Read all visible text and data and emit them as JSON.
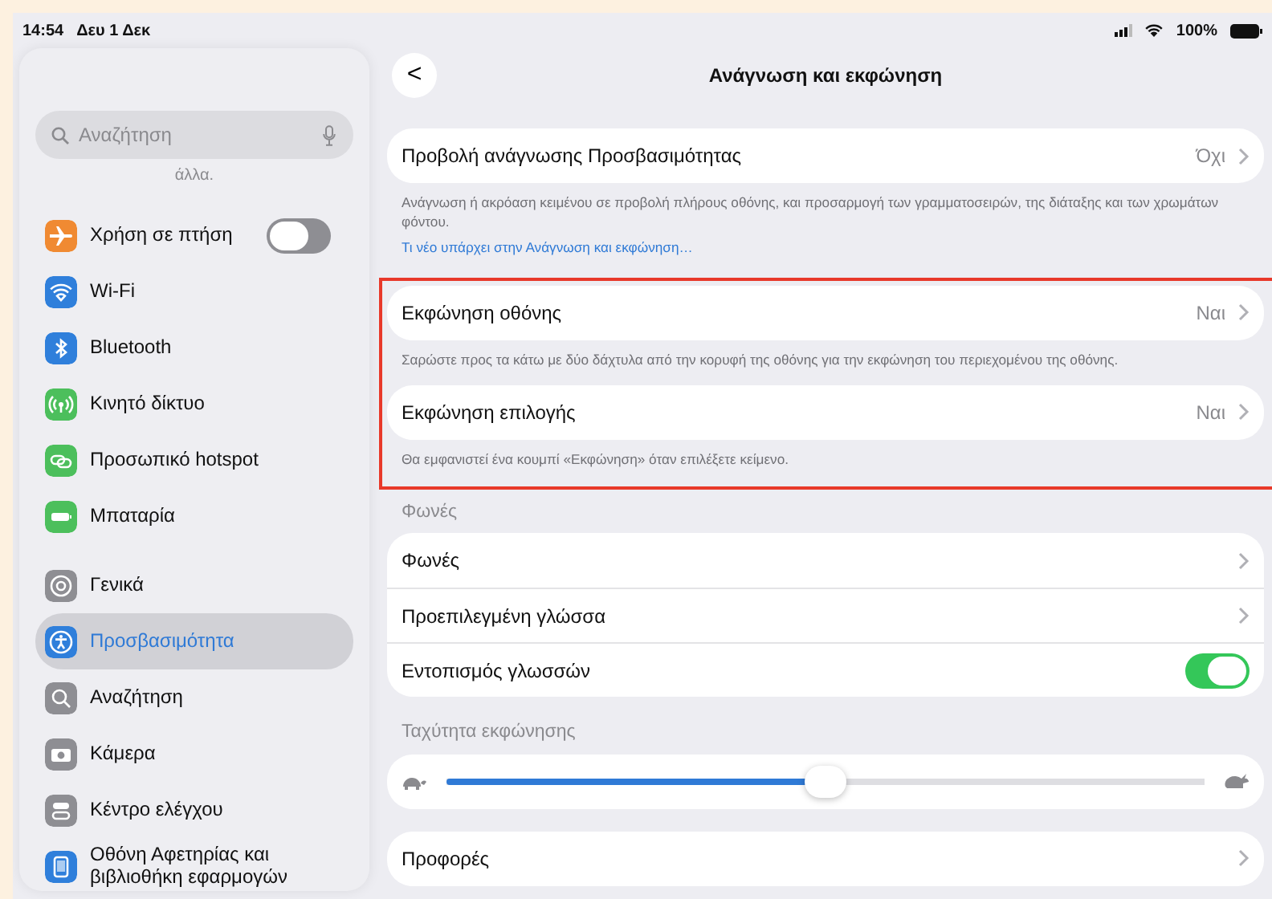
{
  "status_bar": {
    "time": "14:54",
    "date": "Δευ 1 Δεκ",
    "battery": "100%"
  },
  "sidebar": {
    "search": {
      "placeholder": "Αναζήτηση"
    },
    "partial_text": "άλλα.",
    "groups": [
      {
        "items": [
          {
            "label": "Χρήση σε πτήση",
            "color": "#f08a32",
            "kind": "toggle",
            "on": false,
            "selected": false
          },
          {
            "label": "Wi-Fi",
            "color": "#2f7fdb",
            "kind": "link",
            "selected": false
          },
          {
            "label": "Bluetooth",
            "color": "#2f7fdb",
            "kind": "link",
            "selected": false
          },
          {
            "label": "Κινητό δίκτυο",
            "color": "#4cbf5c",
            "kind": "link",
            "selected": false
          },
          {
            "label": "Προσωπικό hotspot",
            "color": "#4cbf5c",
            "kind": "link",
            "selected": false
          },
          {
            "label": "Μπαταρία",
            "color": "#4cbf5c",
            "kind": "link",
            "selected": false
          }
        ]
      },
      {
        "items": [
          {
            "label": "Γενικά",
            "color": "#8e8e93",
            "kind": "link",
            "selected": false
          },
          {
            "label": "Προσβασιμότητα",
            "color": "#2f7fdb",
            "kind": "link",
            "selected": true
          },
          {
            "label": "Αναζήτηση",
            "color": "#8e8e93",
            "kind": "link",
            "selected": false
          },
          {
            "label": "Κάμερα",
            "color": "#8e8e93",
            "kind": "link",
            "selected": false
          },
          {
            "label": "Κέντρο ελέγχου",
            "color": "#8e8e93",
            "kind": "link",
            "selected": false
          },
          {
            "label": "Οθόνη Αφετηρίας και βιβλιοθήκη εφαρμογών",
            "color": "#2f7fdb",
            "kind": "link",
            "selected": false
          }
        ]
      }
    ]
  },
  "main": {
    "back": "<",
    "title": "Ανάγνωση και εκφώνηση",
    "sections": [
      {
        "rows": [
          {
            "kind": "link",
            "label": "Προβολή ανάγνωσης Προσβασιμότητας",
            "value": "Όχι"
          }
        ],
        "footer": "Ανάγνωση ή ακρόαση κειμένου σε προβολή πλήρους οθόνης, και προσαρμογή των γραμματοσειρών, της διάταξης και των χρωμάτων φόντου.",
        "link": "Τι νέο υπάρχει στην Ανάγνωση και εκφώνηση…"
      },
      {
        "kind": "highlight_frame",
        "sections": [
          {
            "rows": [
              {
                "kind": "link",
                "label": "Εκφώνηση οθόνης",
                "value": "Ναι"
              }
            ],
            "footer": "Σαρώστε προς τα κάτω με δύο δάχτυλα από την κορυφή της οθόνης για την εκφώνηση του περιεχομένου της οθόνης."
          },
          {
            "rows": [
              {
                "kind": "link",
                "label": "Εκφώνηση επιλογής",
                "value": "Ναι"
              }
            ],
            "footer": "Θα εμφανιστεί ένα κουμπί «Εκφώνηση» όταν επιλέξετε κείμενο."
          }
        ]
      },
      {
        "header": "Φωνές",
        "rows": [
          {
            "kind": "link",
            "label": "Φωνές"
          },
          {
            "kind": "link",
            "label": "Προεπιλεγμένη γλώσσα"
          },
          {
            "kind": "toggle",
            "label": "Εντοπισμός γλωσσών",
            "on": true
          }
        ]
      },
      {
        "header": "Ταχύτητα εκφώνησης",
        "rows": [
          {
            "kind": "slider",
            "level": 0.5
          }
        ]
      },
      {
        "rows": [
          {
            "kind": "link",
            "label": "Προφορές"
          }
        ]
      }
    ]
  }
}
